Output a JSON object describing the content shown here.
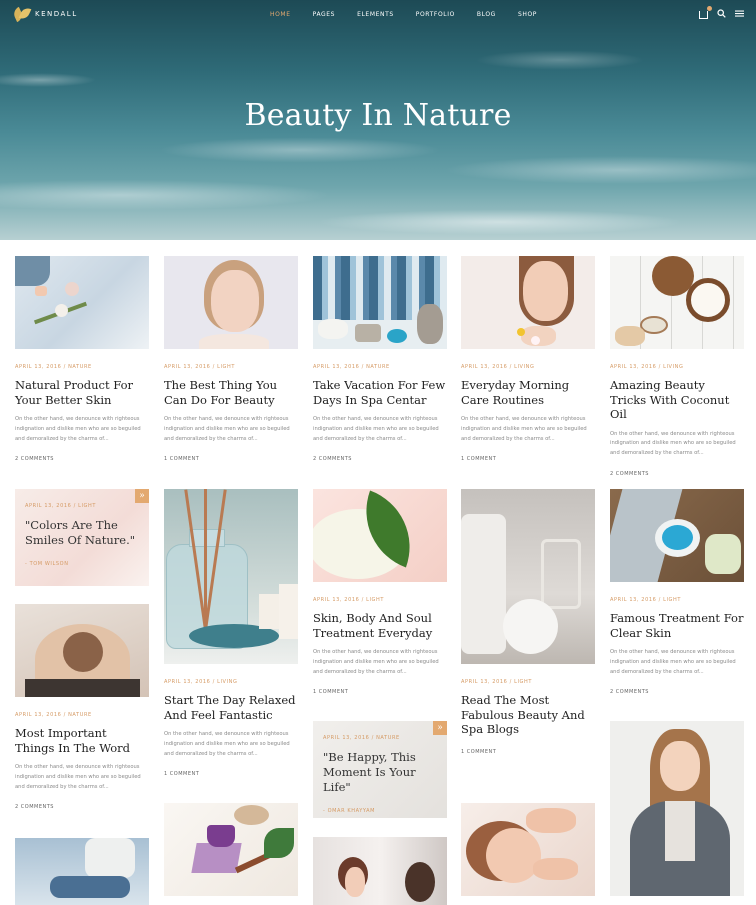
{
  "header": {
    "logo_text": "KENDALL",
    "menu": [
      "HOME",
      "PAGES",
      "ELEMENTS",
      "PORTFOLIO",
      "BLOG",
      "SHOP"
    ]
  },
  "hero": {
    "title": "Beauty In Nature"
  },
  "excerpt": "On the other hand, we denounce with righteous indignation and dislike men who are so beguiled and demoralized by the charms of...",
  "posts": [
    {
      "meta": "APRIL 13, 2016 / NATURE",
      "title": "Natural Product For Your Better Skin",
      "comments": "2 COMMENTS"
    },
    {
      "meta": "APRIL 13, 2016 / LIGHT",
      "title": "The Best Thing You Can Do For Beauty",
      "comments": "1 COMMENT"
    },
    {
      "meta": "APRIL 13, 2016 / NATURE",
      "title": "Take Vacation For Few Days In Spa Centar",
      "comments": "2 COMMENTS"
    },
    {
      "meta": "APRIL 13, 2016 / LIVING",
      "title": "Everyday Morning Care Routines",
      "comments": "1 COMMENT"
    },
    {
      "meta": "APRIL 13, 2016 / LIVING",
      "title": "Amazing Beauty Tricks With Coconut Oil",
      "comments": "2 COMMENTS"
    },
    {
      "meta": "APRIL 13, 2016 / NATURE",
      "title": "Most Important Things In The Word",
      "comments": "2 COMMENTS"
    },
    {
      "meta": "APRIL 13, 2016 / LIVING",
      "title": "Start The Day Relaxed And Feel Fantastic",
      "comments": "1 COMMENT"
    },
    {
      "meta": "APRIL 13, 2016 / LIGHT",
      "title": "Skin, Body And Soul Treatment Everyday",
      "comments": "1 COMMENT"
    },
    {
      "meta": "APRIL 13, 2016 / LIGHT",
      "title": "Read The Most Fabulous Beauty And Spa Blogs",
      "comments": "1 COMMENT"
    },
    {
      "meta": "APRIL 13, 2016 / LIGHT",
      "title": "Famous Treatment For Clear Skin",
      "comments": "2 COMMENTS"
    }
  ],
  "quotes": [
    {
      "meta": "APRIL 13, 2016 / LIGHT",
      "text": "\"Colors Are The Smiles Of Nature.\"",
      "author": "- TOM WILSON"
    },
    {
      "meta": "APRIL 13, 2016 / NATURE",
      "text": "\"Be Happy, This Moment Is Your Life\"",
      "author": "- OMAR KHAYYAM"
    }
  ]
}
